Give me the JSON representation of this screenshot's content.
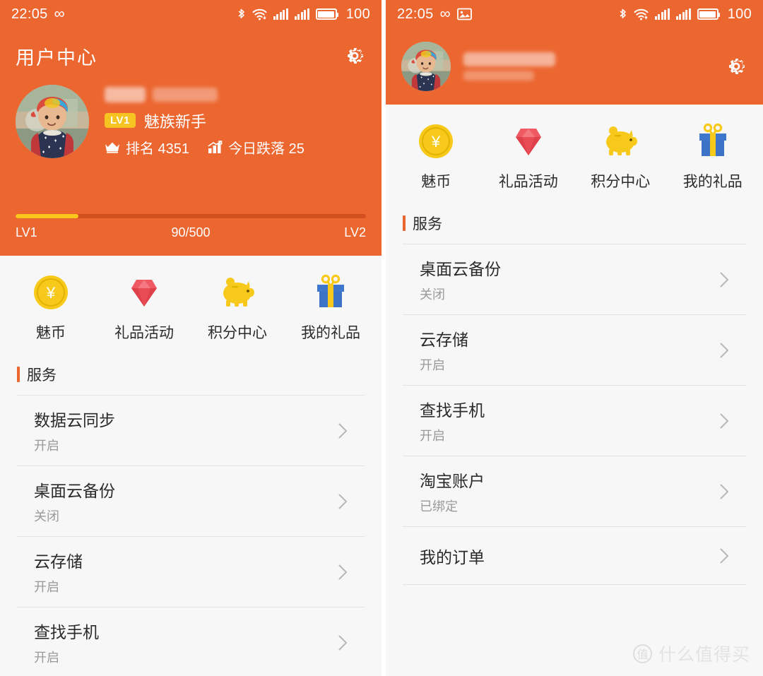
{
  "statusbar": {
    "time": "22:05",
    "infinity_icon": "infinity-icon",
    "screenshot_icon": "image-icon",
    "bluetooth_icon": "bluetooth-icon",
    "wifi_icon": "wifi-icon",
    "signal1_icon": "signal-bars-icon",
    "signal2_icon": "signal-bars-icon",
    "battery_icon": "battery-icon",
    "battery_level": "100"
  },
  "left_panel": {
    "header": {
      "page_title": "用户中心",
      "settings_icon": "gear-icon",
      "avatar": "user-avatar",
      "level_badge": "LV1",
      "level_title": "魅族新手",
      "rank_icon": "crown-icon",
      "rank_label": "排名 4351",
      "trend_icon": "bar-chart-icon",
      "trend_label": "今日跌落 25"
    },
    "progress": {
      "level_from": "LV1",
      "value_text": "90/500",
      "level_to": "LV2",
      "percent": 18,
      "fill_color": "#fcc71d",
      "track_color": "#be3c14"
    },
    "quick_actions": [
      {
        "label": "魅币",
        "icon": "coin-yen-icon"
      },
      {
        "label": "礼品活动",
        "icon": "diamond-icon"
      },
      {
        "label": "积分中心",
        "icon": "piggy-bank-icon"
      },
      {
        "label": "我的礼品",
        "icon": "gift-box-icon"
      }
    ],
    "section_title": "服务",
    "list": [
      {
        "title": "数据云同步",
        "sub": "开启"
      },
      {
        "title": "桌面云备份",
        "sub": "关闭"
      },
      {
        "title": "云存储",
        "sub": "开启"
      },
      {
        "title": "查找手机",
        "sub": "开启"
      }
    ]
  },
  "right_panel": {
    "header": {
      "avatar": "user-avatar",
      "settings_icon": "gear-icon"
    },
    "quick_actions": [
      {
        "label": "魅币",
        "icon": "coin-yen-icon"
      },
      {
        "label": "礼品活动",
        "icon": "diamond-icon"
      },
      {
        "label": "积分中心",
        "icon": "piggy-bank-icon"
      },
      {
        "label": "我的礼品",
        "icon": "gift-box-icon"
      }
    ],
    "section_title": "服务",
    "list": [
      {
        "title": "桌面云备份",
        "sub": "关闭"
      },
      {
        "title": "云存储",
        "sub": "开启"
      },
      {
        "title": "查找手机",
        "sub": "开启"
      },
      {
        "title": "淘宝账户",
        "sub": "已绑定"
      },
      {
        "title": "我的订单",
        "sub": ""
      }
    ]
  },
  "watermark": {
    "logo_char": "值",
    "text": "什么值得买"
  },
  "theme": {
    "orange": "#ec6630",
    "badge_yellow": "#f5c421",
    "page_bg": "#f7f7f7"
  }
}
